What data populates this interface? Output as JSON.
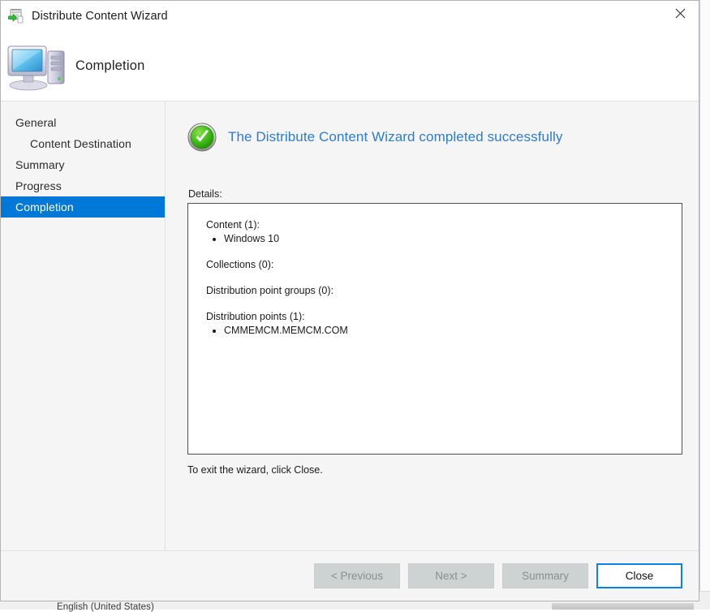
{
  "window": {
    "title": "Distribute Content Wizard",
    "title_icon": "distribute-content-icon",
    "close_icon": "close-icon"
  },
  "header": {
    "title": "Completion",
    "icon": "computer-monitor-icon"
  },
  "sidebar": {
    "items": [
      {
        "label": "General",
        "level": 0,
        "selected": false
      },
      {
        "label": "Content Destination",
        "level": 1,
        "selected": false
      },
      {
        "label": "Summary",
        "level": 0,
        "selected": false
      },
      {
        "label": "Progress",
        "level": 0,
        "selected": false
      },
      {
        "label": "Completion",
        "level": 0,
        "selected": true
      }
    ],
    "selected_color": "#0078d7"
  },
  "content": {
    "status_icon": "success-check-icon",
    "status_color": "#2d7bd4",
    "completion_message": "The Distribute Content Wizard completed successfully",
    "details_label": "Details:",
    "details_groups": [
      {
        "heading": "Content (1):",
        "items": [
          "Windows 10"
        ]
      },
      {
        "heading": "Collections (0):",
        "items": []
      },
      {
        "heading": "Distribution point groups (0):",
        "items": []
      },
      {
        "heading": "Distribution points (1):",
        "items": [
          "CMMEMCM.MEMCM.COM"
        ]
      }
    ],
    "exit_hint": "To exit the wizard, click Close."
  },
  "footer": {
    "previous_label": "< Previous",
    "next_label": "Next >",
    "summary_label": "Summary",
    "close_label": "Close"
  },
  "background": {
    "status_text": "English (United States)"
  }
}
